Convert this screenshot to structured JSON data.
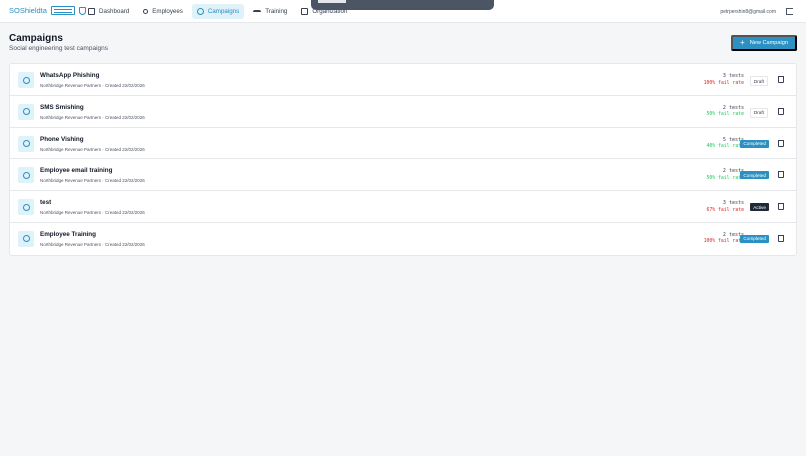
{
  "header": {
    "logo_text": "SOShieldta",
    "nav": [
      {
        "label": "Dashboard",
        "icon": "dashboard-icon"
      },
      {
        "label": "Employees",
        "icon": "users-icon"
      },
      {
        "label": "Campaigns",
        "icon": "target-icon",
        "active": true
      },
      {
        "label": "Training",
        "icon": "graduation-cap-icon"
      },
      {
        "label": "Organization",
        "icon": "building-icon"
      }
    ],
    "user_email": "petrpershin8@gmail.com"
  },
  "page": {
    "title": "Campaigns",
    "subtitle": "Social engineering test campaigns",
    "new_button_label": "New Campaign"
  },
  "campaigns": [
    {
      "name": "WhatsApp Phishing",
      "meta": "Northbridge Revenue Partners · Created 22/02/2026",
      "tests": "3 tests",
      "rate": "100% fail rate",
      "rate_color": "red",
      "status": "Draft",
      "status_style": "draft"
    },
    {
      "name": "SMS Smishing",
      "meta": "Northbridge Revenue Partners · Created 22/02/2026",
      "tests": "2 tests",
      "rate": "50% fail rate",
      "rate_color": "green",
      "status": "Draft",
      "status_style": "draft"
    },
    {
      "name": "Phone Vishing",
      "meta": "Northbridge Revenue Partners · Created 22/02/2026",
      "tests": "5 tests",
      "rate": "40% fail rate",
      "rate_color": "green",
      "status": "Completed",
      "status_style": "completed"
    },
    {
      "name": "Employee email training",
      "meta": "Northbridge Revenue Partners · Created 22/02/2026",
      "tests": "2 tests",
      "rate": "50% fail rate",
      "rate_color": "green",
      "status": "Completed",
      "status_style": "completed"
    },
    {
      "name": "test",
      "meta": "Northbridge Revenue Partners · Created 22/02/2026",
      "tests": "3 tests",
      "rate": "67% fail rate",
      "rate_color": "red",
      "status": "Active",
      "status_style": "active"
    },
    {
      "name": "Employee Training",
      "meta": "Northbridge Revenue Partners · Created 22/02/2026",
      "tests": "2 tests",
      "rate": "100% fail rate",
      "rate_color": "red",
      "status": "Completed",
      "status_style": "completed"
    }
  ],
  "colors": {
    "brand": "#2b90c2",
    "danger": "#dc2626",
    "success": "#22c55e",
    "dark_badge": "#1f2937"
  }
}
